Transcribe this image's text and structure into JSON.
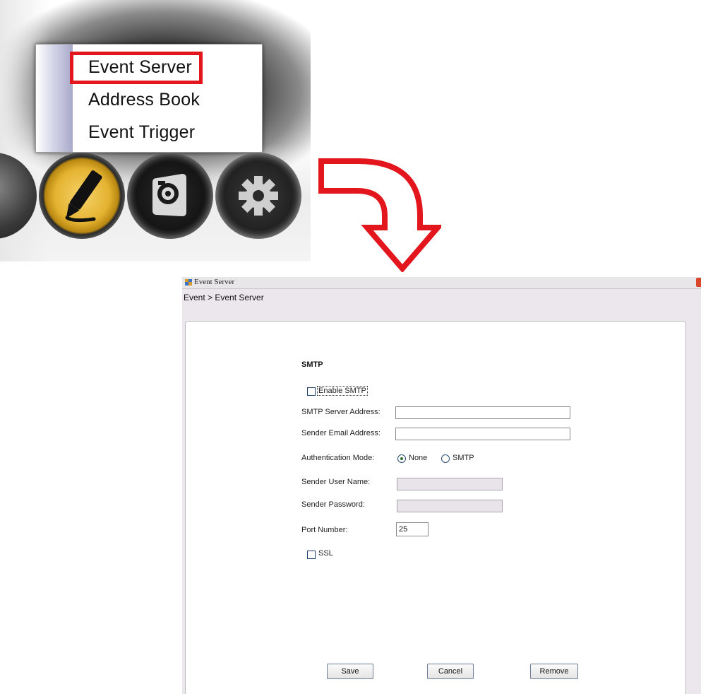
{
  "dock_menu": {
    "items": [
      "Event Server",
      "Address Book",
      "Event Trigger"
    ],
    "highlighted_item": "Event Server",
    "highlight_color": "#e3161d",
    "icons": [
      "edit-pencil-icon",
      "camera-icon",
      "gear-icon"
    ]
  },
  "arrow": {
    "color": "#e3161d"
  },
  "window": {
    "title": "Event Server",
    "breadcrumb": "Event > Event Server",
    "section_title": "SMTP",
    "enable_smtp_label": "Enable SMTP",
    "enable_smtp_checked": false,
    "smtp_server_label": "SMTP Server Address:",
    "smtp_server_value": "",
    "sender_email_label": "Sender Email Address:",
    "sender_email_value": "",
    "auth_mode_label": "Authentication Mode:",
    "auth_options": [
      "None",
      "SMTP"
    ],
    "auth_selected": "None",
    "sender_user_label": "Sender User Name:",
    "sender_user_value": "",
    "sender_password_label": "Sender Password:",
    "sender_password_value": "",
    "port_label": "Port Number:",
    "port_value": "25",
    "ssl_label": "SSL",
    "ssl_checked": false,
    "buttons": {
      "save": "Save",
      "cancel": "Cancel",
      "remove": "Remove"
    }
  }
}
